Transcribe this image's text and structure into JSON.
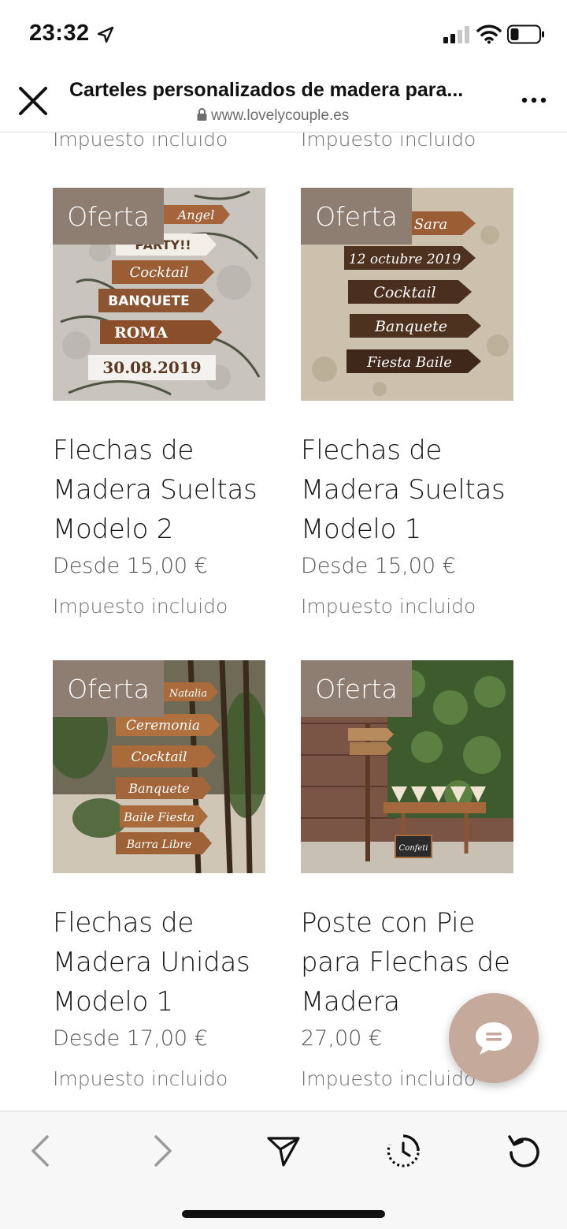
{
  "status_bar": {
    "time": "23:32"
  },
  "browser": {
    "title": "Carteles personalizados de madera para...",
    "url": "www.lovelycouple.es"
  },
  "top_row": {
    "tax_left": "Impuesto incluido",
    "tax_right": "Impuesto incluido"
  },
  "products": [
    {
      "badge": "Oferta",
      "name_lines": [
        "Flechas de",
        "Madera Sueltas",
        "Modelo 2"
      ],
      "price": "Desde 15,00 €",
      "tax": "Impuesto incluido",
      "img_arrows": [
        "Angel",
        "PARTY!!",
        "Cocktail",
        "BANQUETE",
        "ROMA",
        "30.08.2019"
      ]
    },
    {
      "badge": "Oferta",
      "name_lines": [
        "Flechas de",
        "Madera Sueltas",
        "Modelo 1"
      ],
      "price": "Desde 15,00 €",
      "tax": "Impuesto incluido",
      "img_arrows": [
        "Sara",
        "12 octubre 2019",
        "Cocktail",
        "Banquete",
        "Fiesta Baile"
      ]
    },
    {
      "badge": "Oferta",
      "name_lines": [
        "Flechas de",
        "Madera Unidas",
        "Modelo 1"
      ],
      "price": "Desde 17,00 €",
      "tax": "Impuesto incluido",
      "img_arrows": [
        "Natalia",
        "Ceremonia",
        "Cocktail",
        "Banquete",
        "Baile Fiesta",
        "Barra Libre"
      ]
    },
    {
      "badge": "Oferta",
      "name_lines": [
        "Poste con Pie",
        "para Flechas de",
        "Madera"
      ],
      "price": "27,00 €",
      "tax": "Impuesto incluido",
      "img_arrows": [
        "Confeti"
      ]
    }
  ],
  "icons": {
    "close": "close-icon",
    "more": "more-icon",
    "chat": "chat-icon",
    "back": "chevron-left-icon",
    "forward": "chevron-right-icon",
    "share": "send-icon",
    "history": "history-icon",
    "reload": "reload-icon"
  },
  "colors": {
    "offer_badge": "#8e7d71",
    "chat_button": "#c5a99a",
    "wood_dark": "#5a3a22",
    "wood_light": "#a0673a"
  }
}
